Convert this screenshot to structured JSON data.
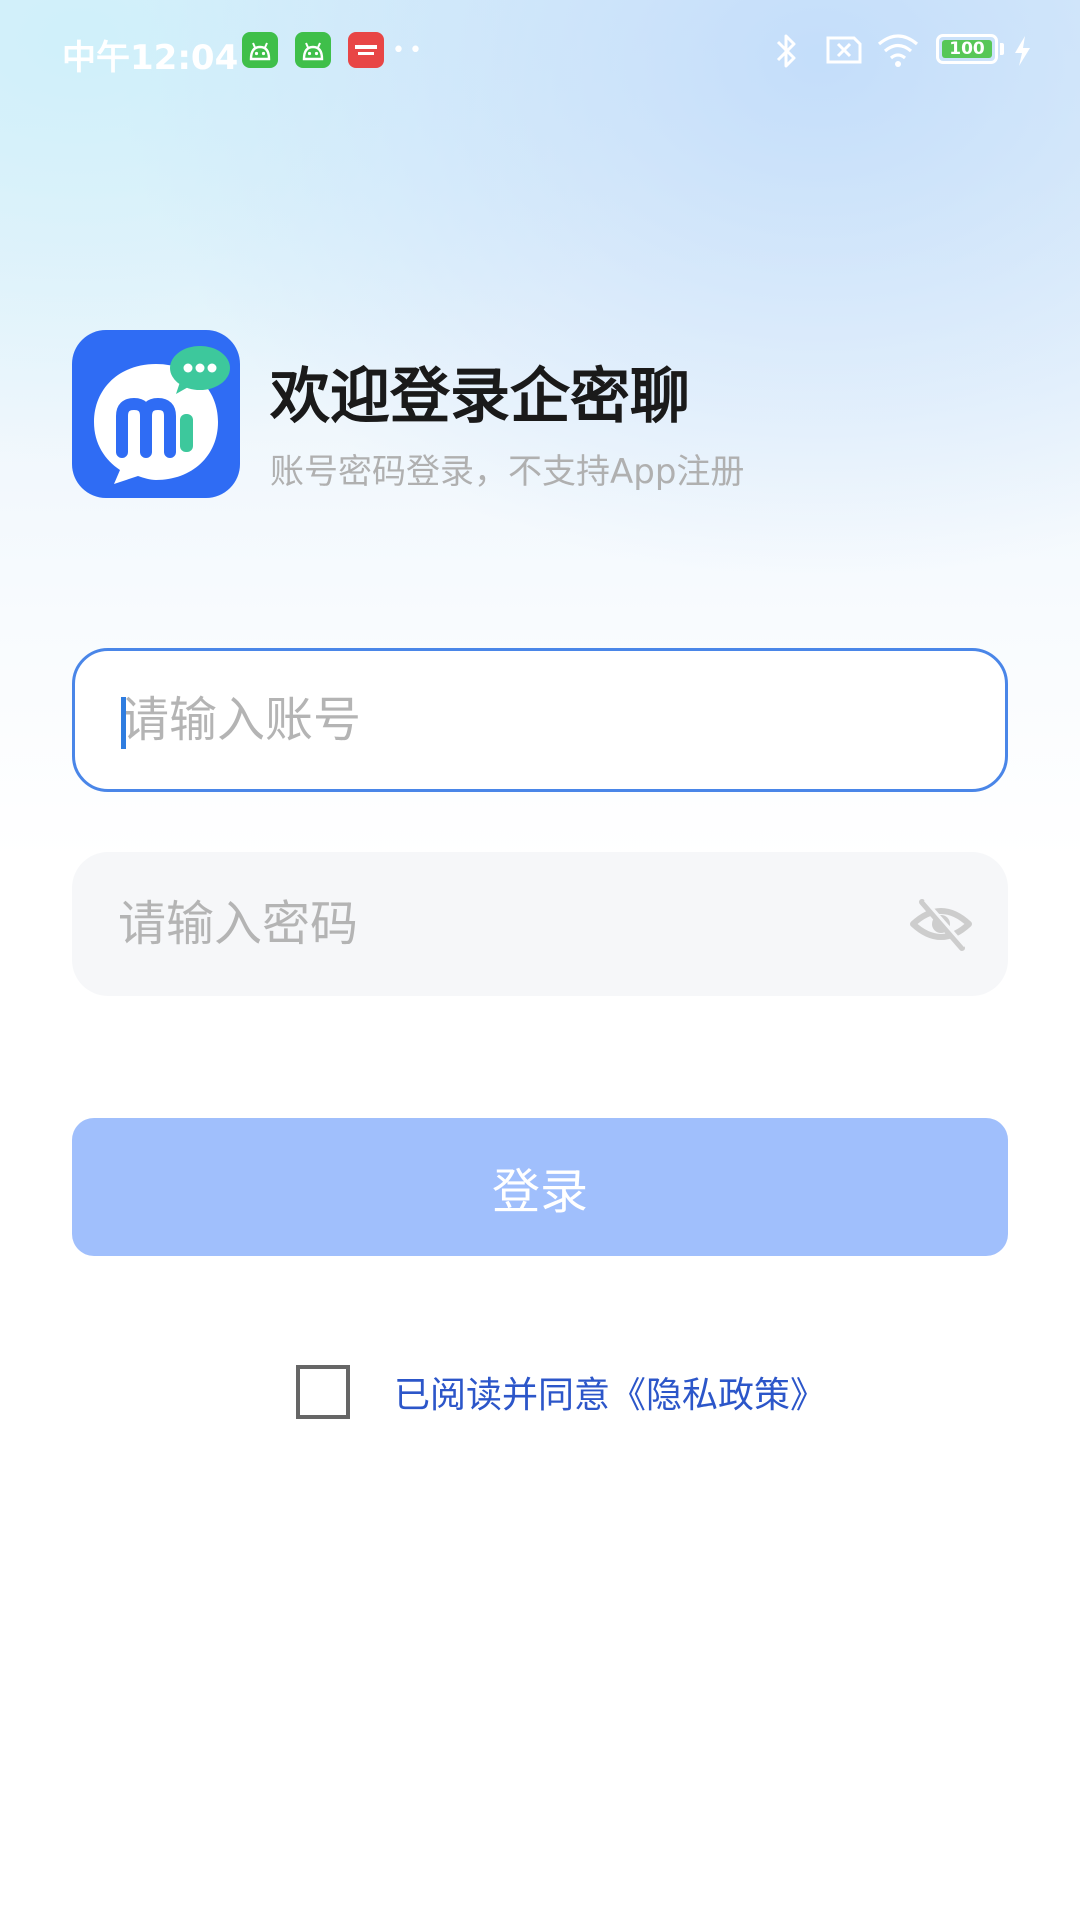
{
  "status_bar": {
    "time": "中午12:04",
    "battery_level": "100",
    "notification_icons": [
      "android-icon",
      "android-icon",
      "news-app-icon"
    ],
    "more_dots": "••",
    "system_icons": [
      "bluetooth-icon",
      "sim-error-icon",
      "wifi-icon",
      "battery-icon",
      "charging-icon"
    ]
  },
  "header": {
    "title": "欢迎登录企密聊",
    "subtitle": "账号密码登录，不支持App注册",
    "logo_icon": "chat-app-logo-icon"
  },
  "form": {
    "account_placeholder": "请输入账号",
    "account_value": "",
    "password_placeholder": "请输入密码",
    "password_value": "",
    "password_toggle_icon": "eye-off-icon"
  },
  "login": {
    "label": "登录"
  },
  "agreement": {
    "checked": false,
    "text": "已阅读并同意《隐私政策》"
  },
  "colors": {
    "accent": "#2f6cf4",
    "button_disabled": "#a0bffc",
    "link": "#2c56c9",
    "input_focus_border": "#4a86e8"
  }
}
